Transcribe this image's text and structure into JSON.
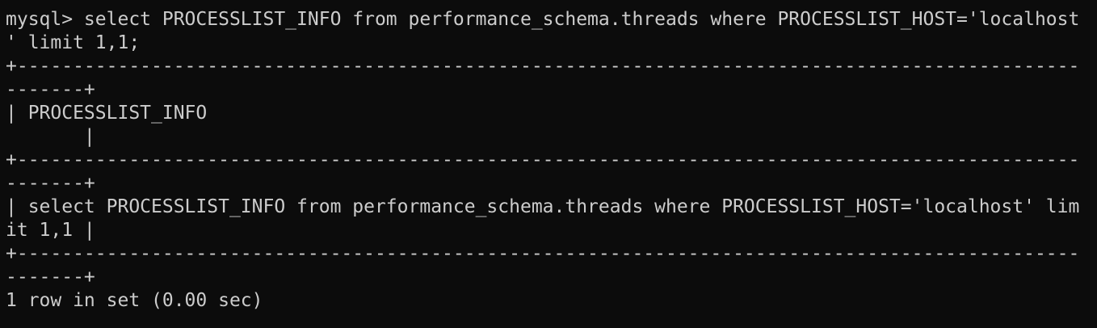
{
  "terminal": {
    "background": "#0c0c0c",
    "foreground": "#cccccc",
    "lines": [
      "mysql> select PROCESSLIST_INFO from performance_schema.threads where PROCESSLIST_HOST='localhost",
      "' limit 1,1;",
      "+-----------------------------------------------------------------------------------------------",
      "-------+",
      "| PROCESSLIST_INFO",
      "       |",
      "+-----------------------------------------------------------------------------------------------",
      "-------+",
      "| select PROCESSLIST_INFO from performance_schema.threads where PROCESSLIST_HOST='localhost' lim",
      "it 1,1 |",
      "+-----------------------------------------------------------------------------------------------",
      "-------+",
      "1 row in set (0.00 sec)"
    ]
  }
}
